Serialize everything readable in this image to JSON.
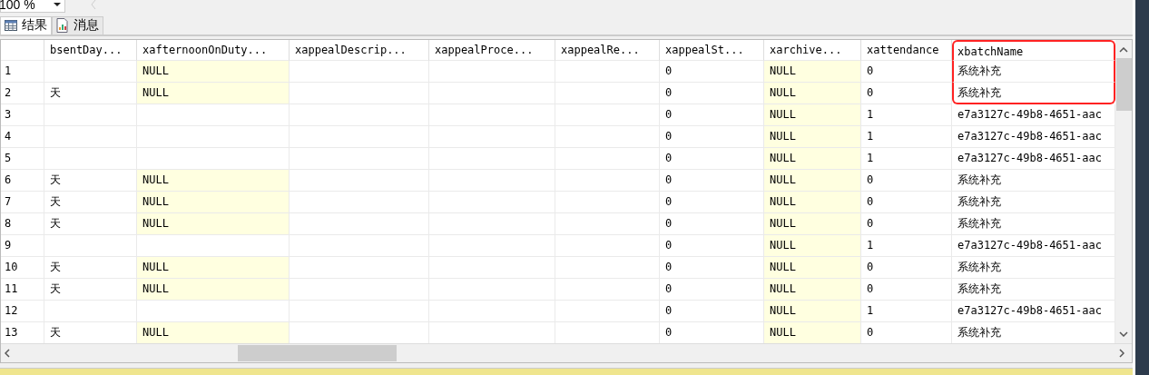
{
  "toolbar": {
    "zoom": "100 %"
  },
  "tabs": [
    {
      "label": "结果",
      "selected": true,
      "kind": "grid"
    },
    {
      "label": "消息",
      "selected": false,
      "kind": "messages"
    }
  ],
  "table": {
    "columns": [
      {
        "highlighted": false
      },
      {
        "label": "bsentDay...",
        "highlighted": false
      },
      {
        "label": "xafternoonOnDuty...",
        "highlighted": false
      },
      {
        "label": "xappealDescrip...",
        "highlighted": false
      },
      {
        "label": "xappealProce...",
        "highlighted": false
      },
      {
        "label": "xappealRe...",
        "highlighted": false
      },
      {
        "label": "xappealSt...",
        "highlighted": false
      },
      {
        "label": "xarchive...",
        "highlighted": false
      },
      {
        "label": "xattendance",
        "highlighted": false
      },
      {
        "label": "xbatchName",
        "highlighted": true
      }
    ],
    "rows": [
      {
        "highlighted": true,
        "cells": [
          {
            "text": "1",
            "null": false
          },
          {
            "null": false
          },
          {
            "text": "NULL",
            "null": true
          },
          {
            "null": false
          },
          {
            "null": false
          },
          {
            "null": false
          },
          {
            "text": "0",
            "null": false
          },
          {
            "text": "NULL",
            "null": true
          },
          {
            "text": "0",
            "null": false
          },
          {
            "text": "系统补充",
            "null": false
          }
        ]
      },
      {
        "highlighted": true,
        "cells": [
          {
            "text": "2",
            "null": false
          },
          {
            "text": "天",
            "null": false
          },
          {
            "text": "NULL",
            "null": true
          },
          {
            "null": false
          },
          {
            "null": false
          },
          {
            "null": false
          },
          {
            "text": "0",
            "null": false
          },
          {
            "text": "NULL",
            "null": true
          },
          {
            "text": "0",
            "null": false
          },
          {
            "text": "系统补充",
            "null": false
          }
        ]
      },
      {
        "highlighted": false,
        "cells": [
          {
            "text": "3",
            "null": false
          },
          {
            "null": false
          },
          {
            "null": false
          },
          {
            "null": false
          },
          {
            "null": false
          },
          {
            "null": false
          },
          {
            "text": "0",
            "null": false
          },
          {
            "text": "NULL",
            "null": true
          },
          {
            "text": "1",
            "null": false
          },
          {
            "text": "e7a3127c-49b8-4651-aac",
            "null": false
          }
        ]
      },
      {
        "highlighted": false,
        "cells": [
          {
            "text": "4",
            "null": false
          },
          {
            "null": false
          },
          {
            "null": false
          },
          {
            "null": false
          },
          {
            "null": false
          },
          {
            "null": false
          },
          {
            "text": "0",
            "null": false
          },
          {
            "text": "NULL",
            "null": true
          },
          {
            "text": "1",
            "null": false
          },
          {
            "text": "e7a3127c-49b8-4651-aac",
            "null": false
          }
        ]
      },
      {
        "highlighted": false,
        "cells": [
          {
            "text": "5",
            "null": false
          },
          {
            "null": false
          },
          {
            "null": false
          },
          {
            "null": false
          },
          {
            "null": false
          },
          {
            "null": false
          },
          {
            "text": "0",
            "null": false
          },
          {
            "text": "NULL",
            "null": true
          },
          {
            "text": "1",
            "null": false
          },
          {
            "text": "e7a3127c-49b8-4651-aac",
            "null": false
          }
        ]
      },
      {
        "highlighted": false,
        "cells": [
          {
            "text": "6",
            "null": false
          },
          {
            "text": "天",
            "null": false
          },
          {
            "text": "NULL",
            "null": true
          },
          {
            "null": false
          },
          {
            "null": false
          },
          {
            "null": false
          },
          {
            "text": "0",
            "null": false
          },
          {
            "text": "NULL",
            "null": true
          },
          {
            "text": "0",
            "null": false
          },
          {
            "text": "系统补充",
            "null": false
          }
        ]
      },
      {
        "highlighted": false,
        "cells": [
          {
            "text": "7",
            "null": false
          },
          {
            "text": "天",
            "null": false
          },
          {
            "text": "NULL",
            "null": true
          },
          {
            "null": false
          },
          {
            "null": false
          },
          {
            "null": false
          },
          {
            "text": "0",
            "null": false
          },
          {
            "text": "NULL",
            "null": true
          },
          {
            "text": "0",
            "null": false
          },
          {
            "text": "系统补充",
            "null": false
          }
        ]
      },
      {
        "highlighted": false,
        "cells": [
          {
            "text": "8",
            "null": false
          },
          {
            "text": "天",
            "null": false
          },
          {
            "text": "NULL",
            "null": true
          },
          {
            "null": false
          },
          {
            "null": false
          },
          {
            "null": false
          },
          {
            "text": "0",
            "null": false
          },
          {
            "text": "NULL",
            "null": true
          },
          {
            "text": "0",
            "null": false
          },
          {
            "text": "系统补充",
            "null": false
          }
        ]
      },
      {
        "highlighted": false,
        "cells": [
          {
            "text": "9",
            "null": false
          },
          {
            "null": false
          },
          {
            "null": false
          },
          {
            "null": false
          },
          {
            "null": false
          },
          {
            "null": false
          },
          {
            "text": "0",
            "null": false
          },
          {
            "text": "NULL",
            "null": true
          },
          {
            "text": "1",
            "null": false
          },
          {
            "text": "e7a3127c-49b8-4651-aac",
            "null": false
          }
        ]
      },
      {
        "highlighted": false,
        "cells": [
          {
            "text": "10",
            "null": false
          },
          {
            "text": "天",
            "null": false
          },
          {
            "text": "NULL",
            "null": true
          },
          {
            "null": false
          },
          {
            "null": false
          },
          {
            "null": false
          },
          {
            "text": "0",
            "null": false
          },
          {
            "text": "NULL",
            "null": true
          },
          {
            "text": "0",
            "null": false
          },
          {
            "text": "系统补充",
            "null": false
          }
        ]
      },
      {
        "highlighted": false,
        "cells": [
          {
            "text": "11",
            "null": false
          },
          {
            "text": "天",
            "null": false
          },
          {
            "text": "NULL",
            "null": true
          },
          {
            "null": false
          },
          {
            "null": false
          },
          {
            "null": false
          },
          {
            "text": "0",
            "null": false
          },
          {
            "text": "NULL",
            "null": true
          },
          {
            "text": "0",
            "null": false
          },
          {
            "text": "系统补充",
            "null": false
          }
        ]
      },
      {
        "highlighted": false,
        "cells": [
          {
            "text": "12",
            "null": false
          },
          {
            "null": false
          },
          {
            "null": false
          },
          {
            "null": false
          },
          {
            "null": false
          },
          {
            "null": false
          },
          {
            "text": "0",
            "null": false
          },
          {
            "text": "NULL",
            "null": true
          },
          {
            "text": "1",
            "null": false
          },
          {
            "text": "e7a3127c-49b8-4651-aac",
            "null": false
          }
        ]
      },
      {
        "highlighted": false,
        "cells": [
          {
            "text": "13",
            "null": false
          },
          {
            "text": "天",
            "null": false
          },
          {
            "text": "NULL",
            "null": true
          },
          {
            "null": false
          },
          {
            "null": false
          },
          {
            "null": false
          },
          {
            "text": "0",
            "null": false
          },
          {
            "text": "NULL",
            "null": true
          },
          {
            "text": "0",
            "null": false
          },
          {
            "text": "系统补充",
            "null": false
          }
        ]
      }
    ]
  }
}
